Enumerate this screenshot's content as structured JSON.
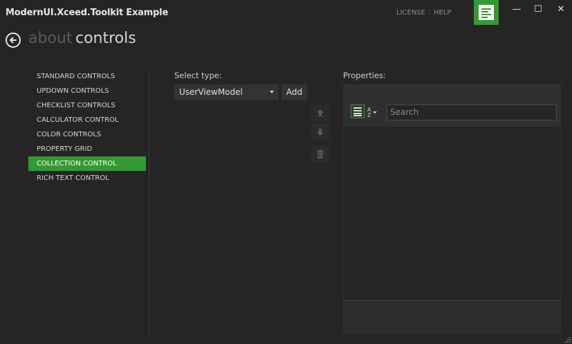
{
  "window": {
    "title": "ModernUI.Xceed.Toolkit Example",
    "links": [
      "LICENSE",
      "HELP"
    ],
    "controls": {
      "minimize": "—",
      "maximize": "☐",
      "close": "✕"
    }
  },
  "nav": {
    "back_icon": "back-arrow-icon",
    "crumbs": [
      "about",
      "controls"
    ]
  },
  "sidebar": {
    "items": [
      {
        "label": "STANDARD CONTROLS"
      },
      {
        "label": "UPDOWN CONTROLS"
      },
      {
        "label": "CHECKLIST CONTROLS"
      },
      {
        "label": "CALCULATOR CONTROL"
      },
      {
        "label": "COLOR CONTROLS"
      },
      {
        "label": "PROPERTY GRID"
      },
      {
        "label": "COLLECTION CONTROL",
        "selected": true
      },
      {
        "label": "RICH TEXT CONTROL"
      }
    ]
  },
  "collection": {
    "select_type_label": "Select type:",
    "selected_type": "UserViewModel",
    "add_label": "Add",
    "side_buttons": [
      "move-up-icon",
      "move-down-icon",
      "delete-icon"
    ]
  },
  "properties": {
    "label": "Properties:",
    "search_placeholder": "Search",
    "categorize_icon": "categorized-icon",
    "sort_icon": "sort-alphabetical-icon"
  },
  "colors": {
    "accent": "#339933",
    "background": "#252525"
  }
}
